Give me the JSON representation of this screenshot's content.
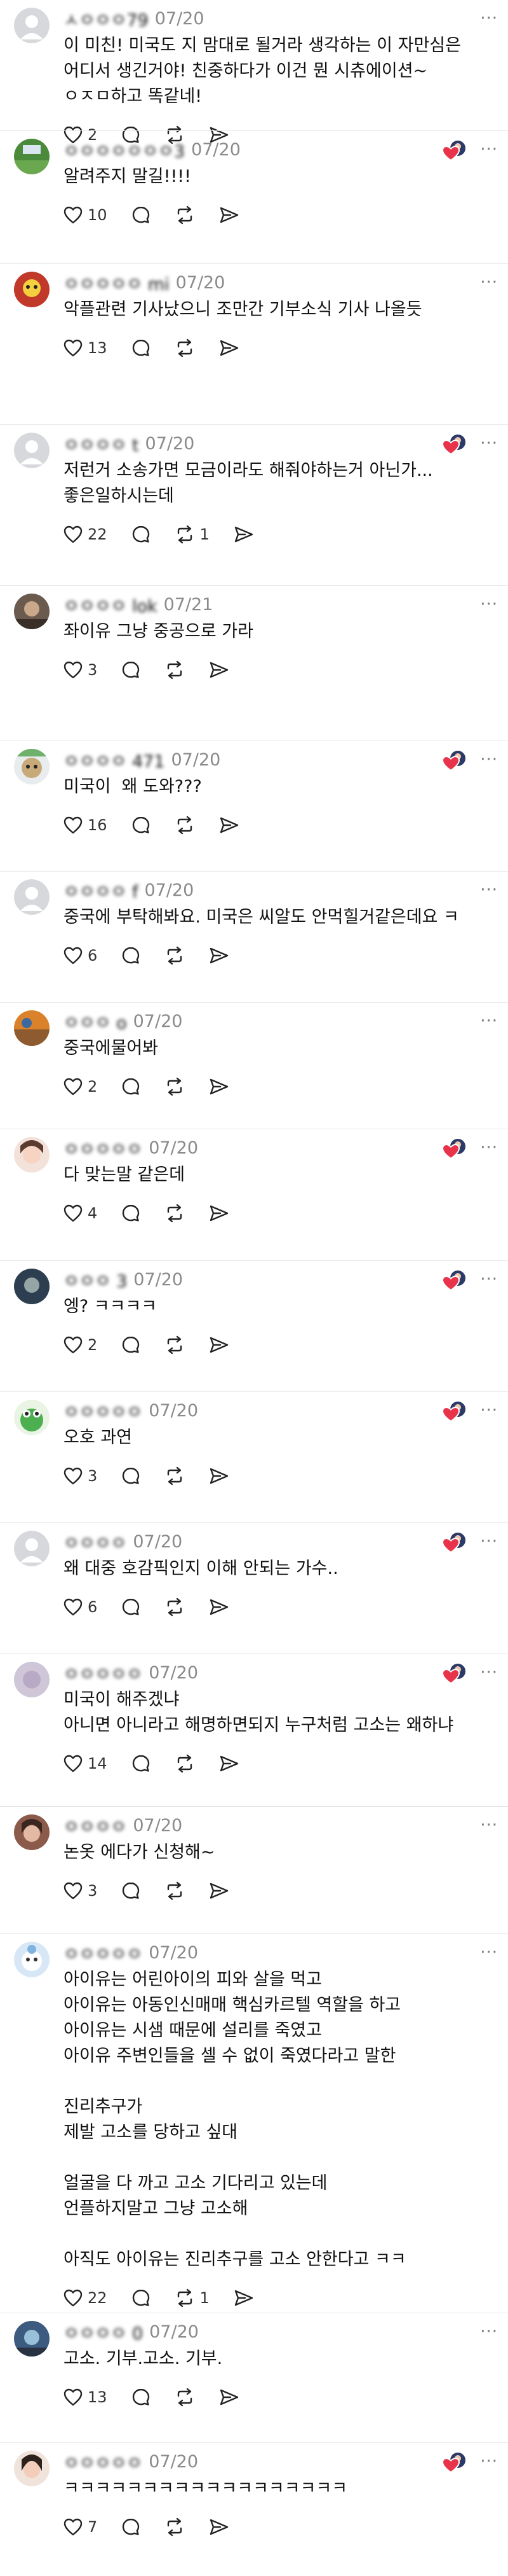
{
  "comments": [
    {
      "user": "ㅅㅇㅇㅇ79",
      "date": "07/20",
      "text": "이 미친! 미국도 지 맘대로 될거라 생각하는 이 자만심은\n어디서 생긴거야! 친중하다가 이건 뭔 시츄에이션~\nㅇㅈㅁ하고 똑같네!",
      "likes": "2",
      "reposts": "",
      "liked_badge": false
    },
    {
      "user": "ㅇㅇㅇㅇㅇㅇㅇ3",
      "date": "07/20",
      "text": "알려주지 말길!!!!",
      "likes": "10",
      "reposts": "",
      "liked_badge": true
    },
    {
      "user": "ㅇㅇㅇㅇㅇ mi",
      "date": "07/20",
      "text": "악플관련 기사났으니 조만간 기부소식 기사 나올듯",
      "likes": "13",
      "reposts": "",
      "liked_badge": false
    },
    {
      "user": "ㅇㅇㅇㅇ t",
      "date": "07/20",
      "text": "저런거 소송가면 모금이라도 해줘야하는거 아닌가...\n좋은일하시는데",
      "likes": "22",
      "reposts": "1",
      "liked_badge": true
    },
    {
      "user": "ㅇㅇㅇㅇ lok",
      "date": "07/21",
      "text": "좌이유 그냥 중공으로 가라",
      "likes": "3",
      "reposts": "",
      "liked_badge": false
    },
    {
      "user": "ㅇㅇㅇㅇ 471",
      "date": "07/20",
      "text": "미국이  왜 도와???",
      "likes": "16",
      "reposts": "",
      "liked_badge": true
    },
    {
      "user": "ㅇㅇㅇㅇ f",
      "date": "07/20",
      "text": "중국에 부탁해봐요. 미국은 씨알도 안먹힐거같은데요 ㅋ",
      "likes": "6",
      "reposts": "",
      "liked_badge": false
    },
    {
      "user": "ㅇㅇㅇ o",
      "date": "07/20",
      "text": "중국에물어봐",
      "likes": "2",
      "reposts": "",
      "liked_badge": false
    },
    {
      "user": "ㅇㅇㅇㅇㅇ",
      "date": "07/20",
      "text": "다 맞는말 같은데",
      "likes": "4",
      "reposts": "",
      "liked_badge": true
    },
    {
      "user": "ㅇㅇㅇ 3",
      "date": "07/20",
      "text": "엥? ㅋㅋㅋㅋ",
      "likes": "2",
      "reposts": "",
      "liked_badge": true
    },
    {
      "user": "ㅇㅇㅇㅇㅇ",
      "date": "07/20",
      "text": "오호 과연",
      "likes": "3",
      "reposts": "",
      "liked_badge": true
    },
    {
      "user": "ㅇㅇㅇㅇ",
      "date": "07/20",
      "text": "왜 대중 호감픽인지 이해 안되는 가수..",
      "likes": "6",
      "reposts": "",
      "liked_badge": true
    },
    {
      "user": "ㅇㅇㅇㅇㅇ",
      "date": "07/20",
      "text": "미국이 해주겠냐\n아니면 아니라고 해명하면되지 누구처럼 고소는 왜하냐",
      "likes": "14",
      "reposts": "",
      "liked_badge": true
    },
    {
      "user": "ㅇㅇㅇㅇ",
      "date": "07/20",
      "text": "논옷 에다가 신청해~",
      "likes": "3",
      "reposts": "",
      "liked_badge": false
    },
    {
      "user": "ㅇㅇㅇㅇㅇ",
      "date": "07/20",
      "text": "아이유는 어린아이의 피와 살을 먹고\n아이유는 아동인신매매 핵심카르텔 역할을 하고\n아이유는 시샘 때문에 설리를 죽였고\n아이유 주변인들을 셀 수 없이 죽였다라고 말한\n\n진리추구가\n제발 고소를 당하고 싶대\n\n얼굴을 다 까고 고소 기다리고 있는데\n언플하지말고 그냥 고소해\n\n아직도 아이유는 진리추구를 고소 안한다고 ㅋㅋ",
      "likes": "22",
      "reposts": "1",
      "liked_badge": false
    },
    {
      "user": "ㅇㅇㅇㅇ 0",
      "date": "07/20",
      "text": "고소. 기부.고소. 기부.",
      "likes": "13",
      "reposts": "",
      "liked_badge": false
    },
    {
      "user": "ㅇㅇㅇㅇㅇ",
      "date": "07/20",
      "text": "ㅋㅋㅋㅋㅋㅋㅋㅋㅋㅋㅋㅋㅋㅋㅋㅋㅋㅋ",
      "likes": "7",
      "reposts": "",
      "liked_badge": true
    }
  ],
  "more_label": "···",
  "icons": {
    "like": "heart-icon",
    "reply": "reply-bubble-icon",
    "repost": "repost-icon",
    "share": "send-icon",
    "badge": "liked-by-author-badge-icon"
  },
  "colors": {
    "badge_heart": "#e8344a",
    "badge_avatar": "#2b3a67",
    "divider": "#e6e6e6",
    "date": "#8a8a8a"
  }
}
